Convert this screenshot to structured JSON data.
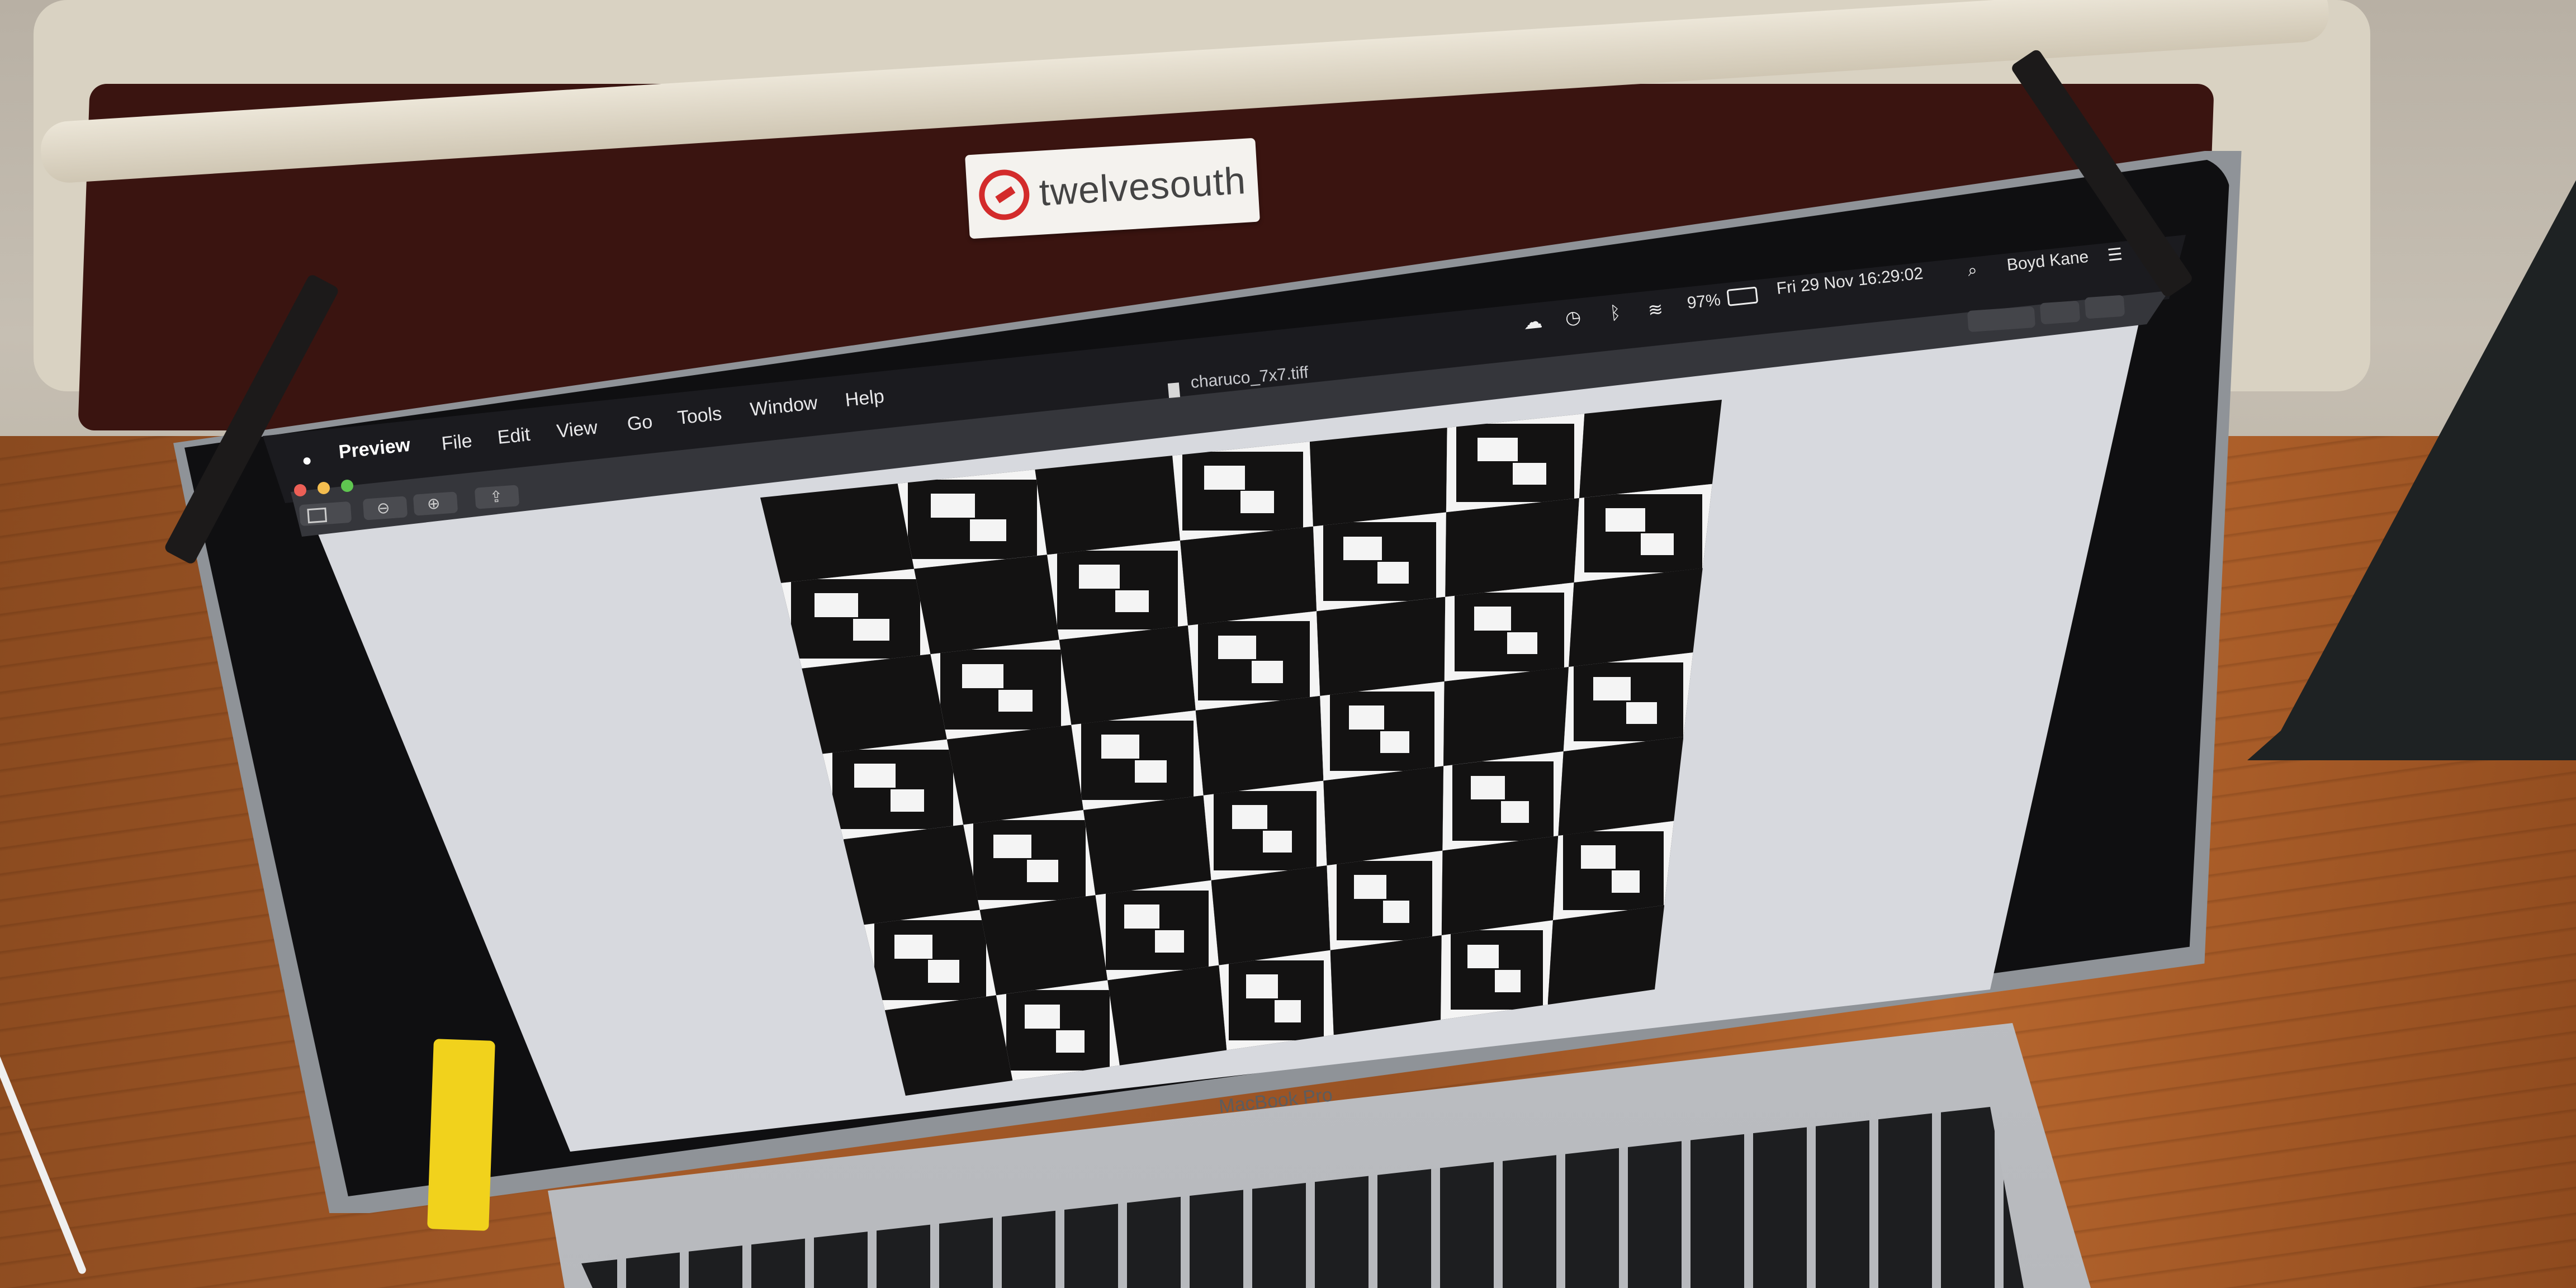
{
  "tag": {
    "brand": "twelvesouth"
  },
  "menubar": {
    "items": [
      "Preview",
      "File",
      "Edit",
      "View",
      "Go",
      "Tools",
      "Window",
      "Help"
    ]
  },
  "status": {
    "battery": "97%",
    "datetime": "Fri 29 Nov  16:29:02",
    "user": "Boyd Kane"
  },
  "window": {
    "title": "charuco_7x7.tiff"
  },
  "laptop": {
    "brand": "MacBook Pro"
  },
  "icons": [
    "apple-icon",
    "cloud-icon",
    "time-machine-icon",
    "bluetooth-icon",
    "wifi-icon",
    "battery-icon",
    "search-icon",
    "control-center-icon",
    "sidebar-icon",
    "zoom-out-icon",
    "zoom-in-icon",
    "share-icon",
    "document-icon"
  ],
  "colors": {
    "screen_bg": "#d7d9de",
    "menubar": "#1b1b1f",
    "board_black": "#131212",
    "marker_white": "#f4f4f4",
    "close": "#ec5f56",
    "minimize": "#f4bd4f",
    "maximize": "#5fc650"
  }
}
